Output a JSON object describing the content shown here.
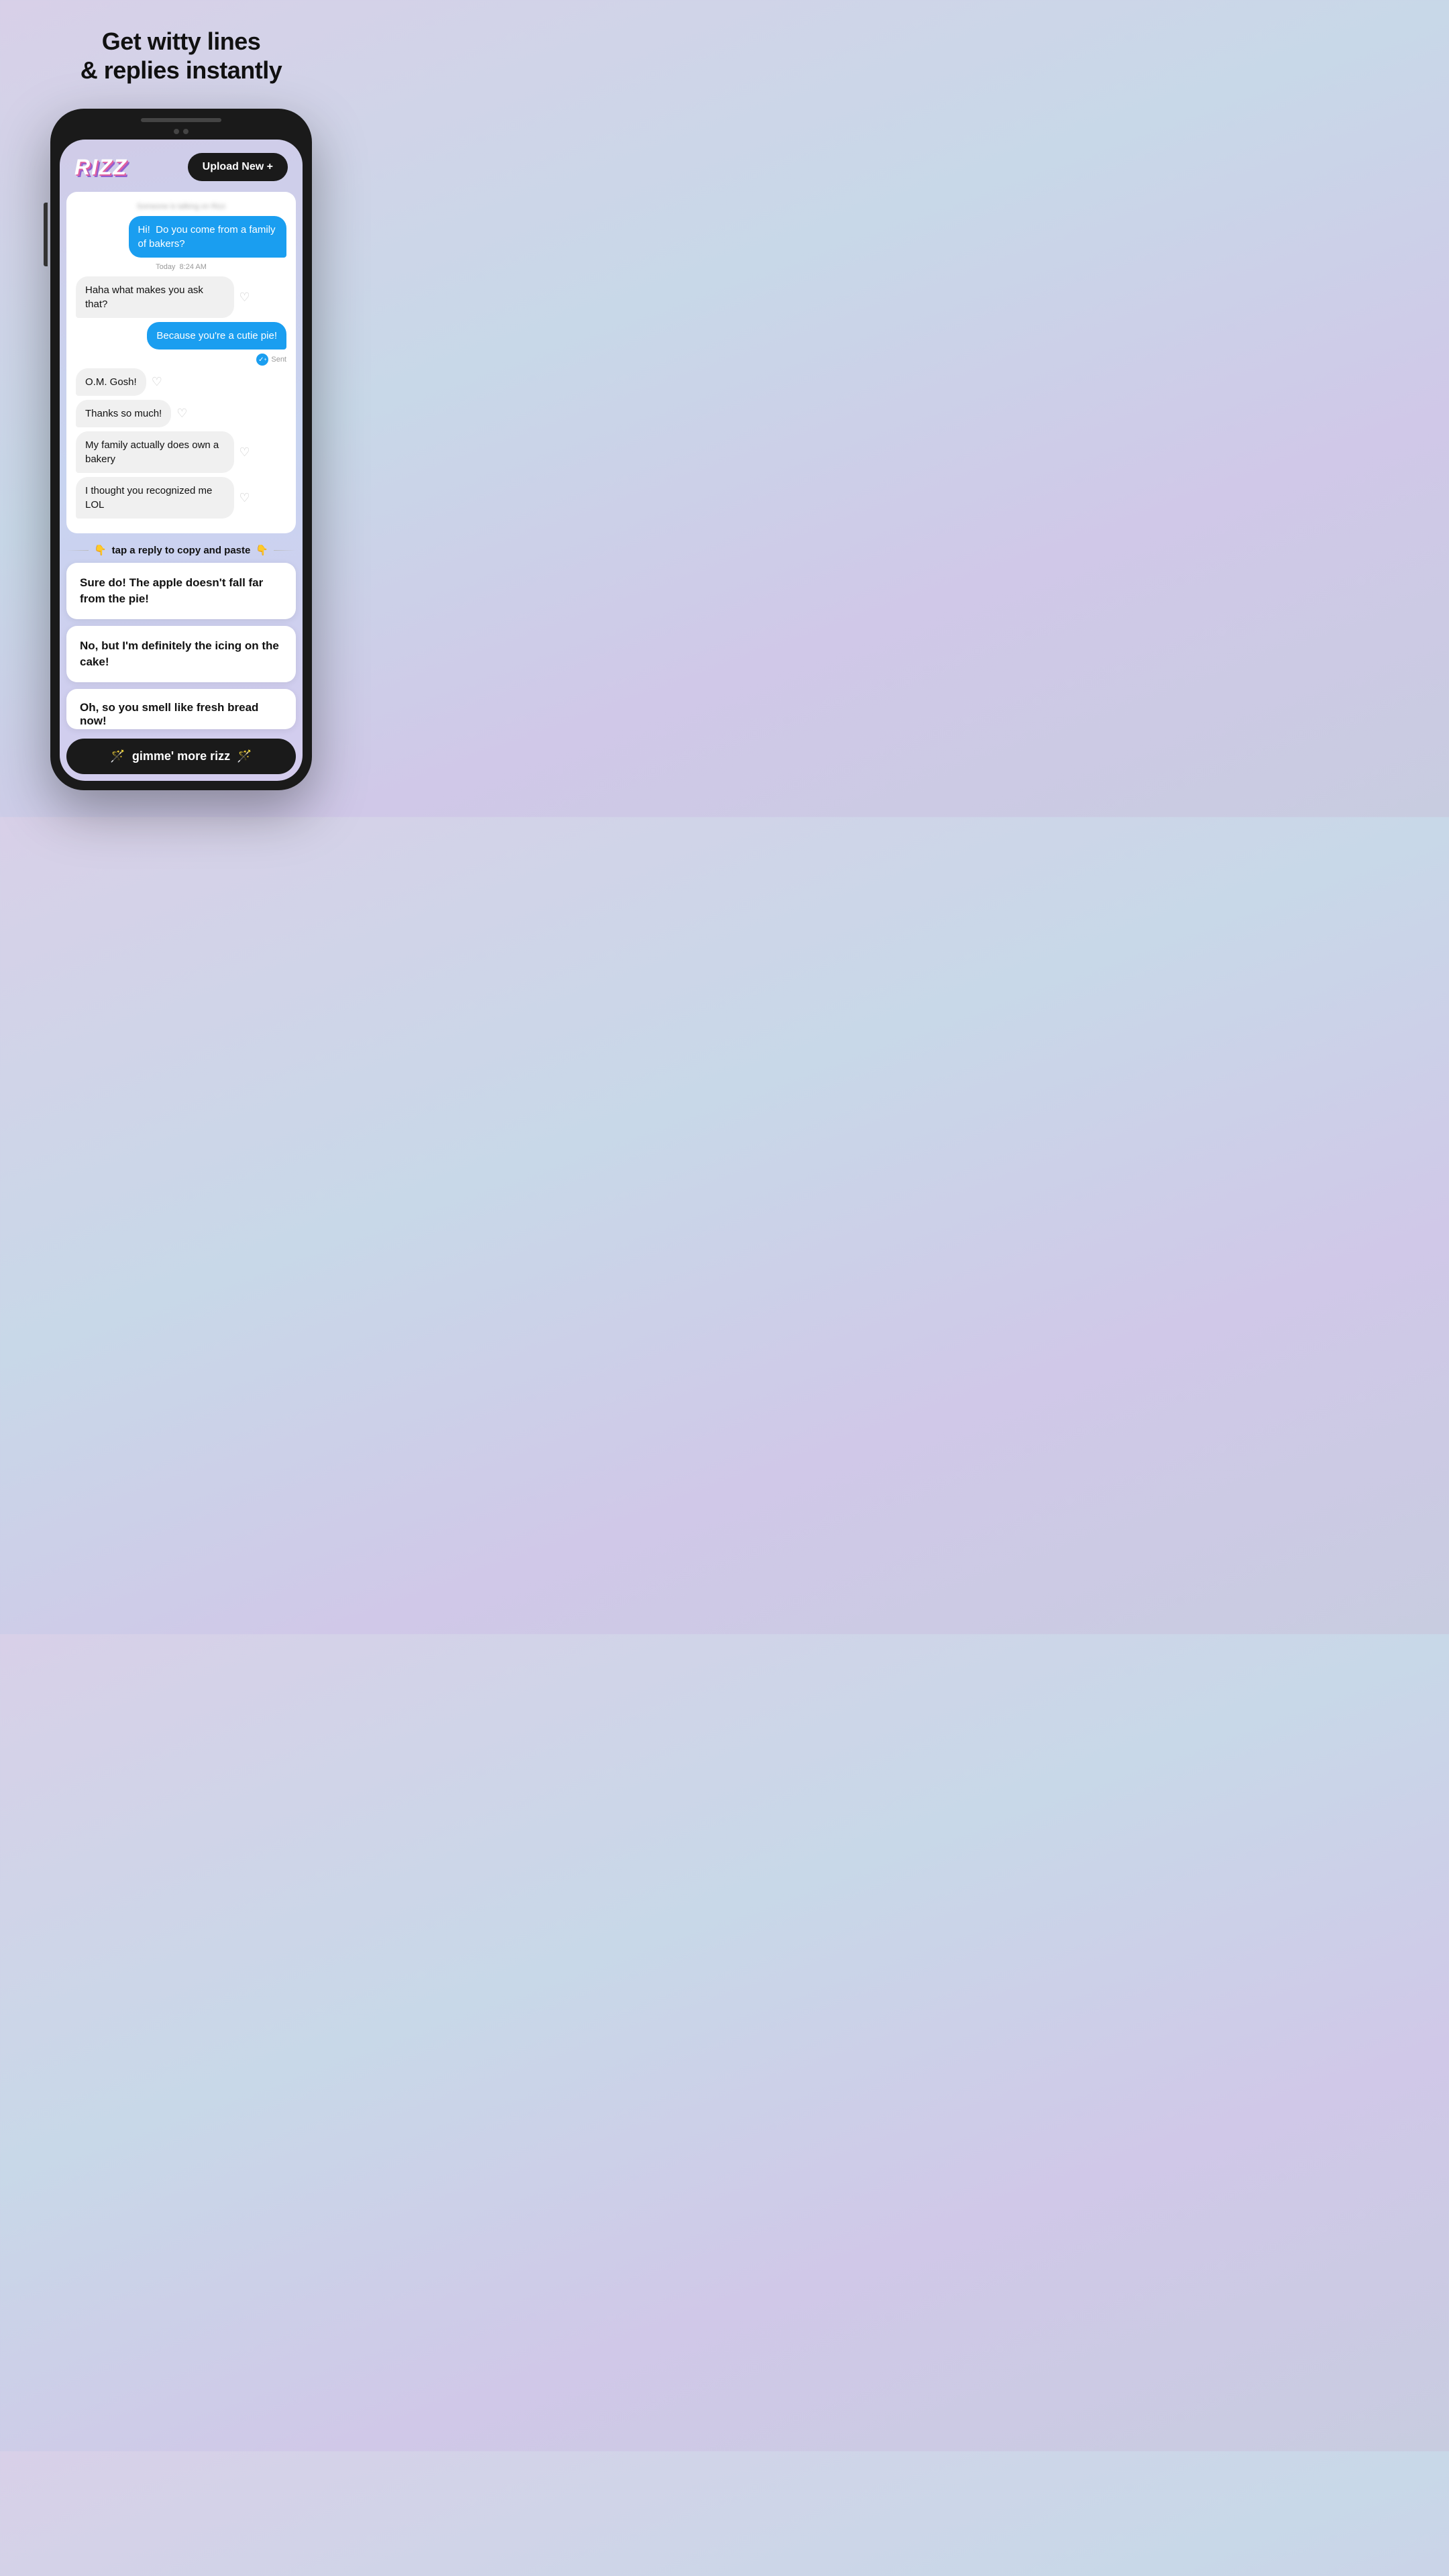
{
  "headline": {
    "line1": "Get witty lines",
    "line2": "& replies instantly"
  },
  "header": {
    "logo": "RIZZ",
    "upload_button": "Upload New +"
  },
  "chat": {
    "blur_hint": "Someone is talking on Rizz",
    "messages": [
      {
        "type": "sent",
        "text": "Hi!  Do you come from a family of bakers?"
      },
      {
        "timestamp": "Today  8:24 AM"
      },
      {
        "type": "received",
        "text": "Haha what makes you ask that?"
      },
      {
        "type": "sent",
        "text": "Because you're a cutie pie!"
      },
      {
        "type": "sent_status",
        "text": "Sent"
      },
      {
        "type": "received",
        "text": "O.M. Gosh!"
      },
      {
        "type": "received",
        "text": "Thanks so much!"
      },
      {
        "type": "received",
        "text": "My family actually does own a bakery"
      },
      {
        "type": "received",
        "text": "I thought you recognized me LOL"
      }
    ]
  },
  "tap_hint": {
    "emoji_left": "👇",
    "text": "tap a reply to copy and paste",
    "emoji_right": "👇"
  },
  "replies": [
    {
      "text": "Sure do! The apple doesn't fall far from the pie!"
    },
    {
      "text": "No, but I'm definitely the icing on the cake!"
    },
    {
      "text": "Oh, so you smell like fresh bread now!"
    }
  ],
  "gimme_button": {
    "emoji_left": "🪄",
    "text": "gimme' more rizz",
    "emoji_right": "🪄"
  }
}
